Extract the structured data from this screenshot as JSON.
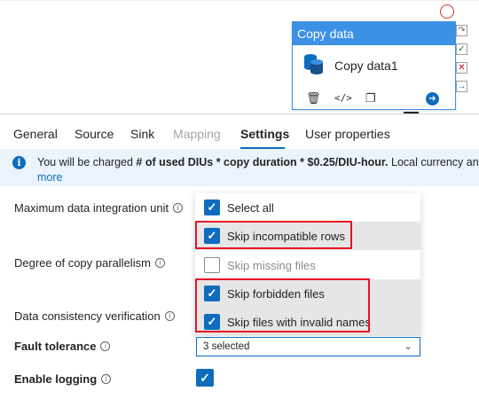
{
  "activity": {
    "header": "Copy data",
    "name": "Copy data1",
    "actions": {
      "delete": "🗑",
      "code": "</>",
      "clone": "❐",
      "go": "➜"
    }
  },
  "tabs": [
    {
      "label": "General"
    },
    {
      "label": "Source"
    },
    {
      "label": "Sink"
    },
    {
      "label": "Mapping"
    },
    {
      "label": "Settings"
    },
    {
      "label": "User properties"
    }
  ],
  "info": {
    "prefix": "You will be charged ",
    "bold": "# of used DIUs * copy duration * $0.25/DIU-hour.",
    "suffix": " Local currency and",
    "more": "more"
  },
  "form": {
    "diu_label": "Maximum data integration unit",
    "parallel_label": "Degree of copy parallelism",
    "consistency_label": "Data consistency verification",
    "fault_label": "Fault tolerance",
    "logging_label": "Enable logging"
  },
  "fault_options": [
    {
      "label": "Select all",
      "checked": true
    },
    {
      "label": "Skip incompatible rows",
      "checked": true
    },
    {
      "label": "Skip missing files",
      "checked": false
    },
    {
      "label": "Skip forbidden files",
      "checked": true
    },
    {
      "label": "Skip files with invalid names",
      "checked": true
    }
  ],
  "fault_select": {
    "value": "3 selected"
  },
  "enable_logging": true,
  "colors": {
    "accent": "#0f6cbd",
    "highlight": "#e81123",
    "info_bg": "#ebf3fc"
  }
}
